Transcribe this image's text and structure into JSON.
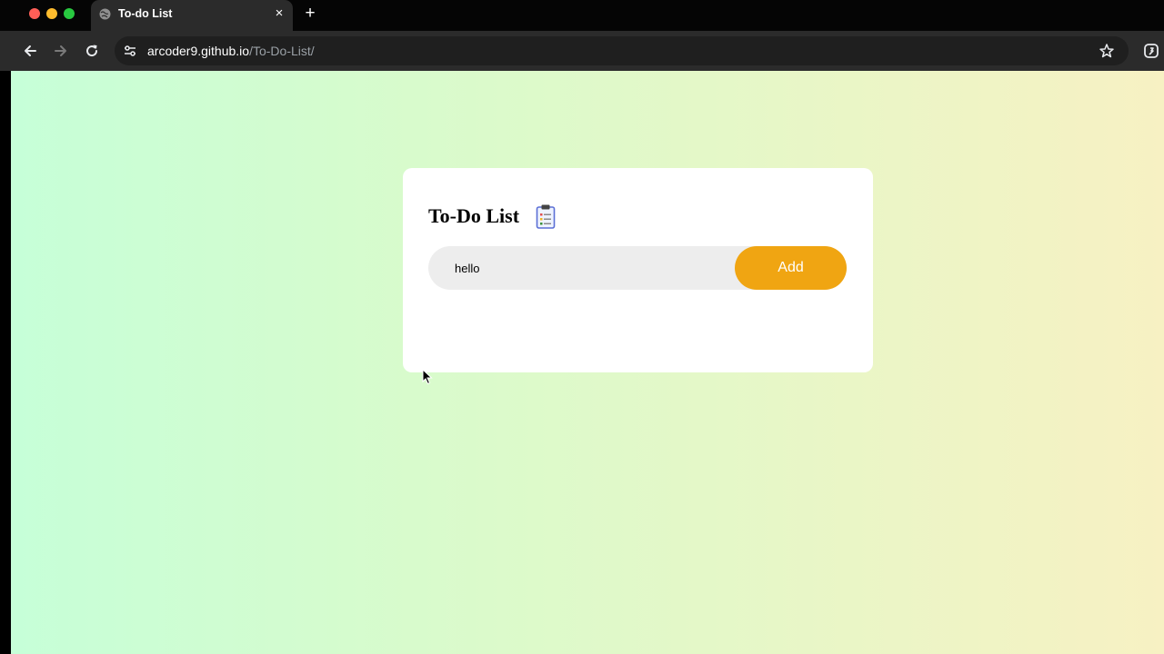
{
  "browser": {
    "tab": {
      "title": "To-do List",
      "favicon": "globe-icon",
      "close_icon": "close-icon"
    },
    "new_tab_icon": "plus-icon",
    "toolbar": {
      "back_icon": "arrow-left-icon",
      "forward_icon": "arrow-right-icon",
      "reload_icon": "reload-icon",
      "site_info_icon": "tune-icon",
      "bookmark_icon": "star-icon",
      "extension_icon": "extension-icon"
    },
    "url": {
      "host": "arcoder9.github.io",
      "path": "/To-Do-List/"
    }
  },
  "app": {
    "title": "To-Do List",
    "title_icon": "clipboard-icon",
    "input": {
      "value": "hello",
      "placeholder": ""
    },
    "add_label": "Add"
  },
  "colors": {
    "accent": "#f0a512",
    "gradient_start": "#c6ffd8",
    "gradient_end": "#f7f1c3",
    "card_bg": "#ffffff",
    "input_bg": "#ededed"
  }
}
